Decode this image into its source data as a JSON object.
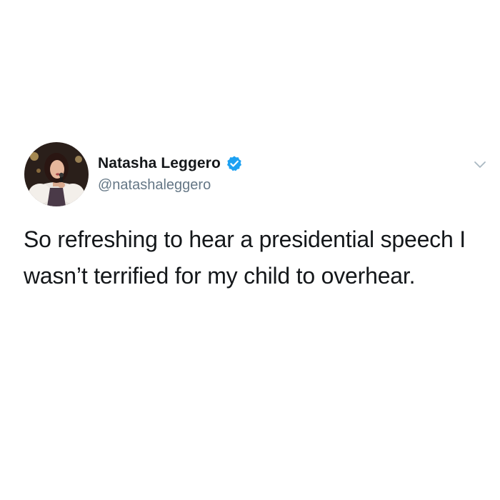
{
  "tweet": {
    "author": {
      "name": "Natasha Leggero",
      "handle": "@natashaleggero",
      "verified": true,
      "avatar_icon": "profile-photo"
    },
    "text": "So refreshing to hear a presidential speech I wasn’t terrified for my child to overhear.",
    "menu_icon": "chevron-down-icon"
  },
  "colors": {
    "background": "#ffffff",
    "text_primary": "#14171a",
    "text_secondary": "#657786",
    "verified_badge": "#1da1f2",
    "chevron": "#aab8c2"
  }
}
